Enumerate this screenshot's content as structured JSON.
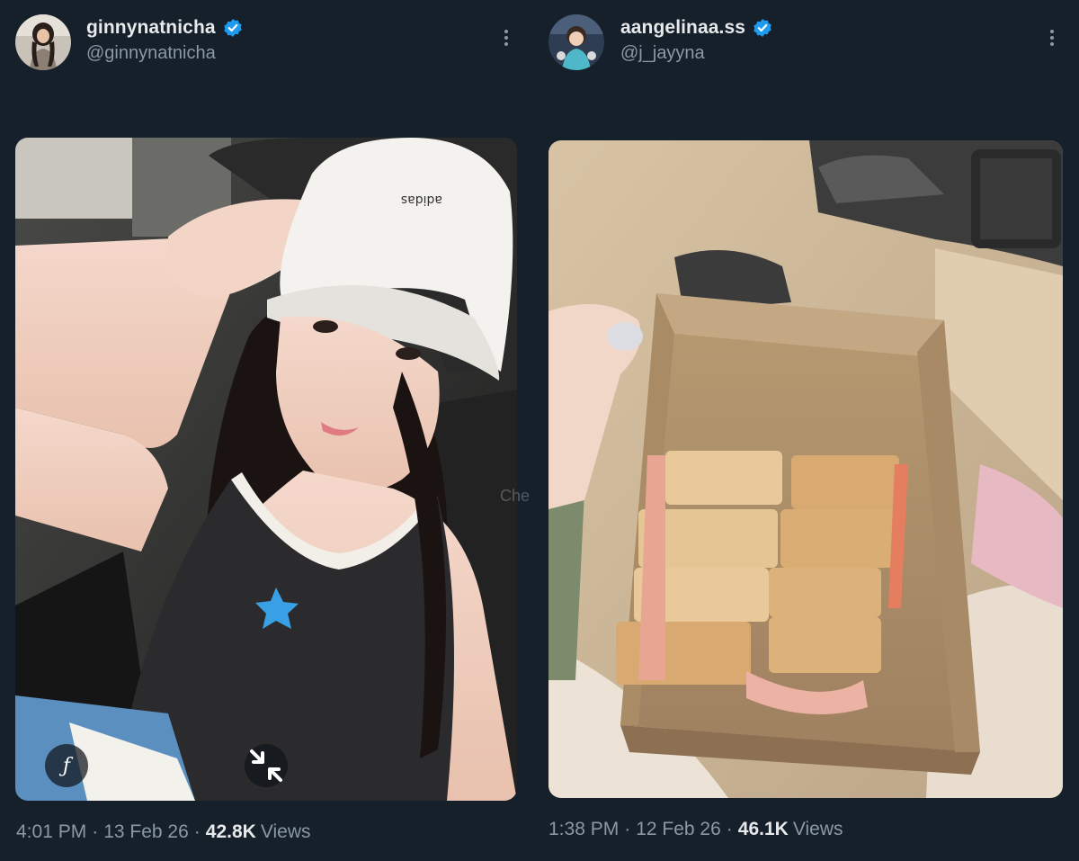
{
  "posts": [
    {
      "display_name": "ginnynatnicha",
      "handle": "@ginnynatnicha",
      "verified": true,
      "time": "4:01 PM",
      "date": "13 Feb 26",
      "views_count": "42.8K",
      "views_label": "Views",
      "media_buttons": {
        "filter_icon": "f-icon",
        "collapse_icon": "collapse-icon"
      }
    },
    {
      "display_name": "aangelinaa.ss",
      "handle": "@j_jayyna",
      "verified": true,
      "time": "1:38 PM",
      "date": "12 Feb 26",
      "views_count": "46.1K",
      "views_label": "Views"
    }
  ],
  "separator": "·",
  "colors": {
    "background": "#15202b",
    "primary_text": "#e7e9ea",
    "secondary_text": "#8b98a5",
    "verified_blue": "#1d9bf0"
  },
  "filter_glyph": "ƒ",
  "watermark_text": "Che"
}
